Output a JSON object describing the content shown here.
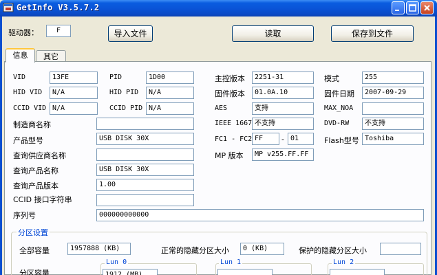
{
  "window": {
    "title": "GetInfo V3.5.7.2"
  },
  "toolbar": {
    "drive_label": "驱动器：",
    "drive_value": "F",
    "import_button": "导入文件",
    "read_button": "读取",
    "save_button": "保存到文件"
  },
  "tabs": [
    {
      "label": "信息",
      "active": true
    },
    {
      "label": "其它",
      "active": false
    }
  ],
  "info": {
    "vid": {
      "label": "VID",
      "value": "13FE"
    },
    "pid": {
      "label": "PID",
      "value": "1D00"
    },
    "controller_version": {
      "label": "主控版本",
      "value": "2251-31"
    },
    "mode": {
      "label": "模式",
      "value": "255"
    },
    "hid_vid": {
      "label": "HID VID",
      "value": "N/A"
    },
    "hid_pid": {
      "label": "HID PID",
      "value": "N/A"
    },
    "firmware_version": {
      "label": "固件版本",
      "value": "01.0A.10"
    },
    "firmware_date": {
      "label": "固件日期",
      "value": "2007-09-29"
    },
    "ccid_vid": {
      "label": "CCID VID",
      "value": "N/A"
    },
    "ccid_pid": {
      "label": "CCID PID",
      "value": "N/A"
    },
    "aes": {
      "label": "AES",
      "value": "支持"
    },
    "max_noa": {
      "label": "MAX_NOA",
      "value": ""
    },
    "manufacturer": {
      "label": "制造商名称",
      "value": ""
    },
    "ieee1667": {
      "label": "IEEE 1667",
      "value": "不支持"
    },
    "dvd_rw": {
      "label": "DVD-RW",
      "value": "不支持"
    },
    "product_model": {
      "label": "产品型号",
      "value": "USB DISK 30X"
    },
    "fc1_fc2": {
      "label": "FC1 - FC2",
      "fc1": "FF",
      "separator": "-",
      "fc2": "01"
    },
    "flash_model": {
      "label": "Flash型号",
      "value": "Toshiba"
    },
    "query_vendor": {
      "label": "查询供应商名称",
      "value": ""
    },
    "mp_version": {
      "label": "MP 版本",
      "value": "MP v255.FF.FF"
    },
    "query_product": {
      "label": "查询产品名称",
      "value": "USB DISK 30X"
    },
    "query_product_version": {
      "label": "查询产品版本",
      "value": "1.00"
    },
    "ccid_interface": {
      "label": "CCID 接口字符串",
      "value": ""
    },
    "serial": {
      "label": "序列号",
      "value": "000000000000"
    }
  },
  "partition": {
    "title": "分区设置",
    "total_capacity": {
      "label": "全部容量",
      "value": "1957888 (KB)"
    },
    "normal_hidden": {
      "label": "正常的隐藏分区大小",
      "value": "0 (KB)"
    },
    "protected_hidden": {
      "label": "保护的隐藏分区大小",
      "value": ""
    },
    "partition_capacity": {
      "label": "分区容量"
    },
    "luns": [
      {
        "title": "Lun 0",
        "value": "1912 (MB)"
      },
      {
        "title": "Lun 1",
        "value": ""
      },
      {
        "title": "Lun 2",
        "value": ""
      }
    ]
  },
  "colors": {
    "titlebar": "#0a53d6",
    "group_title": "#0046d5",
    "window_bg": "#ece9d8",
    "tab_highlight": "#ffc73c"
  }
}
